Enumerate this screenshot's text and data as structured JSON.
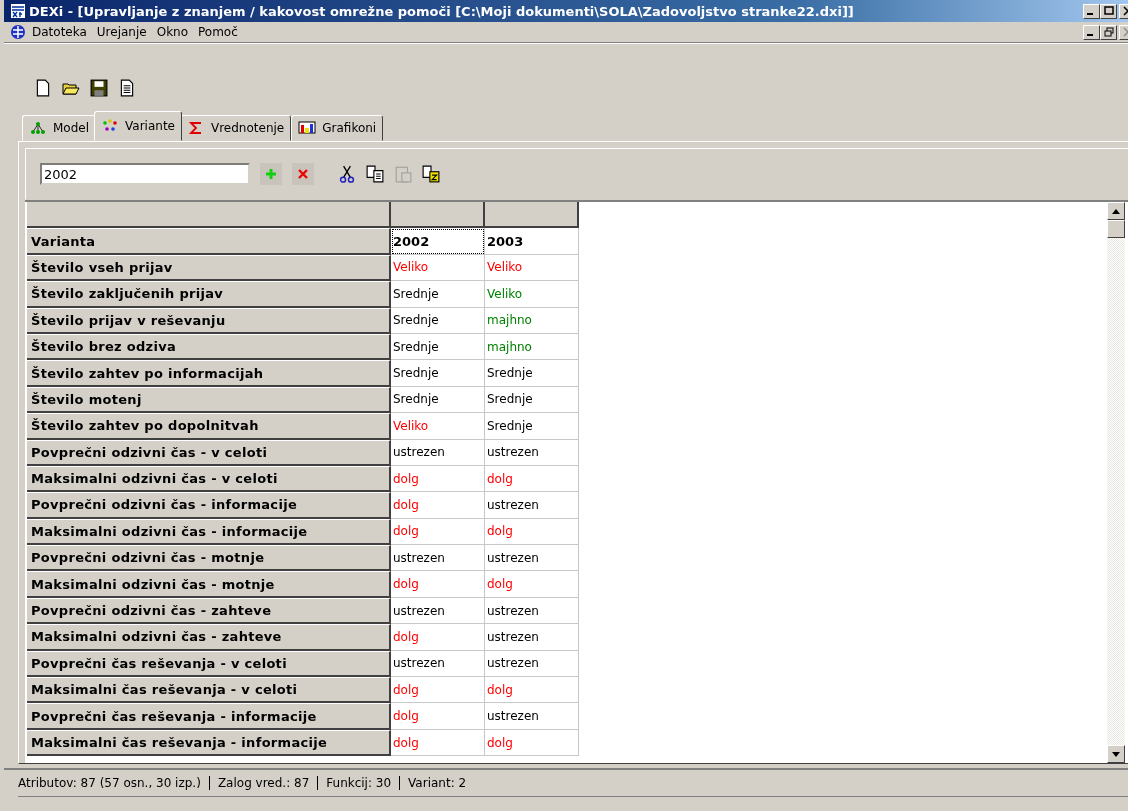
{
  "window": {
    "title": "DEXi - [Upravljanje z znanjem / kakovost omrežne pomoči [C:\\Moji dokumenti\\SOLA\\Zadovoljstvo stranke22.dxi]]"
  },
  "menu": [
    "Datoteka",
    "Urejanje",
    "Okno",
    "Pomoč"
  ],
  "tabs": [
    {
      "label": "Model",
      "kind": "model",
      "selected": false
    },
    {
      "label": "Variante",
      "kind": "variants",
      "selected": true
    },
    {
      "label": "Vrednotenje",
      "kind": "sigma",
      "selected": false
    },
    {
      "label": "Grafikoni",
      "kind": "chart",
      "selected": false
    }
  ],
  "variant_field": {
    "value": "2002"
  },
  "paste_disabled": true,
  "table": {
    "corner": "Varianta",
    "variants": [
      {
        "label": "2002",
        "focused": true
      },
      {
        "label": "2003",
        "focused": false
      }
    ],
    "rows": [
      {
        "attribute": "Število vseh prijav",
        "values": [
          {
            "text": "Veliko",
            "color": "#ff0000"
          },
          {
            "text": "Veliko",
            "color": "#ff0000"
          }
        ]
      },
      {
        "attribute": "Število zaključenih prijav",
        "values": [
          {
            "text": "Srednje",
            "color": "#000000"
          },
          {
            "text": "Veliko",
            "color": "#008000"
          }
        ]
      },
      {
        "attribute": "Število prijav v reševanju",
        "values": [
          {
            "text": "Srednje",
            "color": "#000000"
          },
          {
            "text": "majhno",
            "color": "#008000"
          }
        ]
      },
      {
        "attribute": "Število brez odziva",
        "values": [
          {
            "text": "Srednje",
            "color": "#000000"
          },
          {
            "text": "majhno",
            "color": "#008000"
          }
        ]
      },
      {
        "attribute": "Število zahtev po informacijah",
        "values": [
          {
            "text": "Srednje",
            "color": "#000000"
          },
          {
            "text": "Srednje",
            "color": "#000000"
          }
        ]
      },
      {
        "attribute": "Število motenj",
        "values": [
          {
            "text": "Srednje",
            "color": "#000000"
          },
          {
            "text": "Srednje",
            "color": "#000000"
          }
        ]
      },
      {
        "attribute": "Število zahtev po dopolnitvah",
        "values": [
          {
            "text": "Veliko",
            "color": "#ff0000"
          },
          {
            "text": "Srednje",
            "color": "#000000"
          }
        ]
      },
      {
        "attribute": "Povprečni odzivni čas - v celoti",
        "values": [
          {
            "text": "ustrezen",
            "color": "#000000"
          },
          {
            "text": "ustrezen",
            "color": "#000000"
          }
        ]
      },
      {
        "attribute": "Maksimalni odzivni čas - v celoti",
        "values": [
          {
            "text": "dolg",
            "color": "#ff0000"
          },
          {
            "text": "dolg",
            "color": "#ff0000"
          }
        ]
      },
      {
        "attribute": "Povprečni odzivni čas - informacije",
        "values": [
          {
            "text": "dolg",
            "color": "#ff0000"
          },
          {
            "text": "ustrezen",
            "color": "#000000"
          }
        ]
      },
      {
        "attribute": "Maksimalni odzivni čas - informacije",
        "values": [
          {
            "text": "dolg",
            "color": "#ff0000"
          },
          {
            "text": "dolg",
            "color": "#ff0000"
          }
        ]
      },
      {
        "attribute": "Povprečni odzivni čas - motnje",
        "values": [
          {
            "text": "ustrezen",
            "color": "#000000"
          },
          {
            "text": "ustrezen",
            "color": "#000000"
          }
        ]
      },
      {
        "attribute": "Maksimalni odzivni čas - motnje",
        "values": [
          {
            "text": "dolg",
            "color": "#ff0000"
          },
          {
            "text": "dolg",
            "color": "#ff0000"
          }
        ]
      },
      {
        "attribute": "Povprečni odzivni čas - zahteve",
        "values": [
          {
            "text": "ustrezen",
            "color": "#000000"
          },
          {
            "text": "ustrezen",
            "color": "#000000"
          }
        ]
      },
      {
        "attribute": "Maksimalni odzivni čas - zahteve",
        "values": [
          {
            "text": "dolg",
            "color": "#ff0000"
          },
          {
            "text": "ustrezen",
            "color": "#000000"
          }
        ]
      },
      {
        "attribute": "Povprečni čas reševanja - v celoti",
        "values": [
          {
            "text": "ustrezen",
            "color": "#000000"
          },
          {
            "text": "ustrezen",
            "color": "#000000"
          }
        ]
      },
      {
        "attribute": "Maksimalni čas reševanja - v celoti",
        "values": [
          {
            "text": "dolg",
            "color": "#ff0000"
          },
          {
            "text": "dolg",
            "color": "#ff0000"
          }
        ]
      },
      {
        "attribute": "Povprečni čas reševanja - informacije",
        "values": [
          {
            "text": "dolg",
            "color": "#ff0000"
          },
          {
            "text": "ustrezen",
            "color": "#000000"
          }
        ]
      },
      {
        "attribute": "Maksimalni čas reševanja - informacije",
        "values": [
          {
            "text": "dolg",
            "color": "#ff0000"
          },
          {
            "text": "dolg",
            "color": "#ff0000"
          }
        ]
      }
    ]
  },
  "status_bar": [
    "Atributov: 87 (57 osn., 30 izp.)",
    "Zalog vred.: 87",
    "Funkcij: 30",
    "Variant: 2"
  ]
}
